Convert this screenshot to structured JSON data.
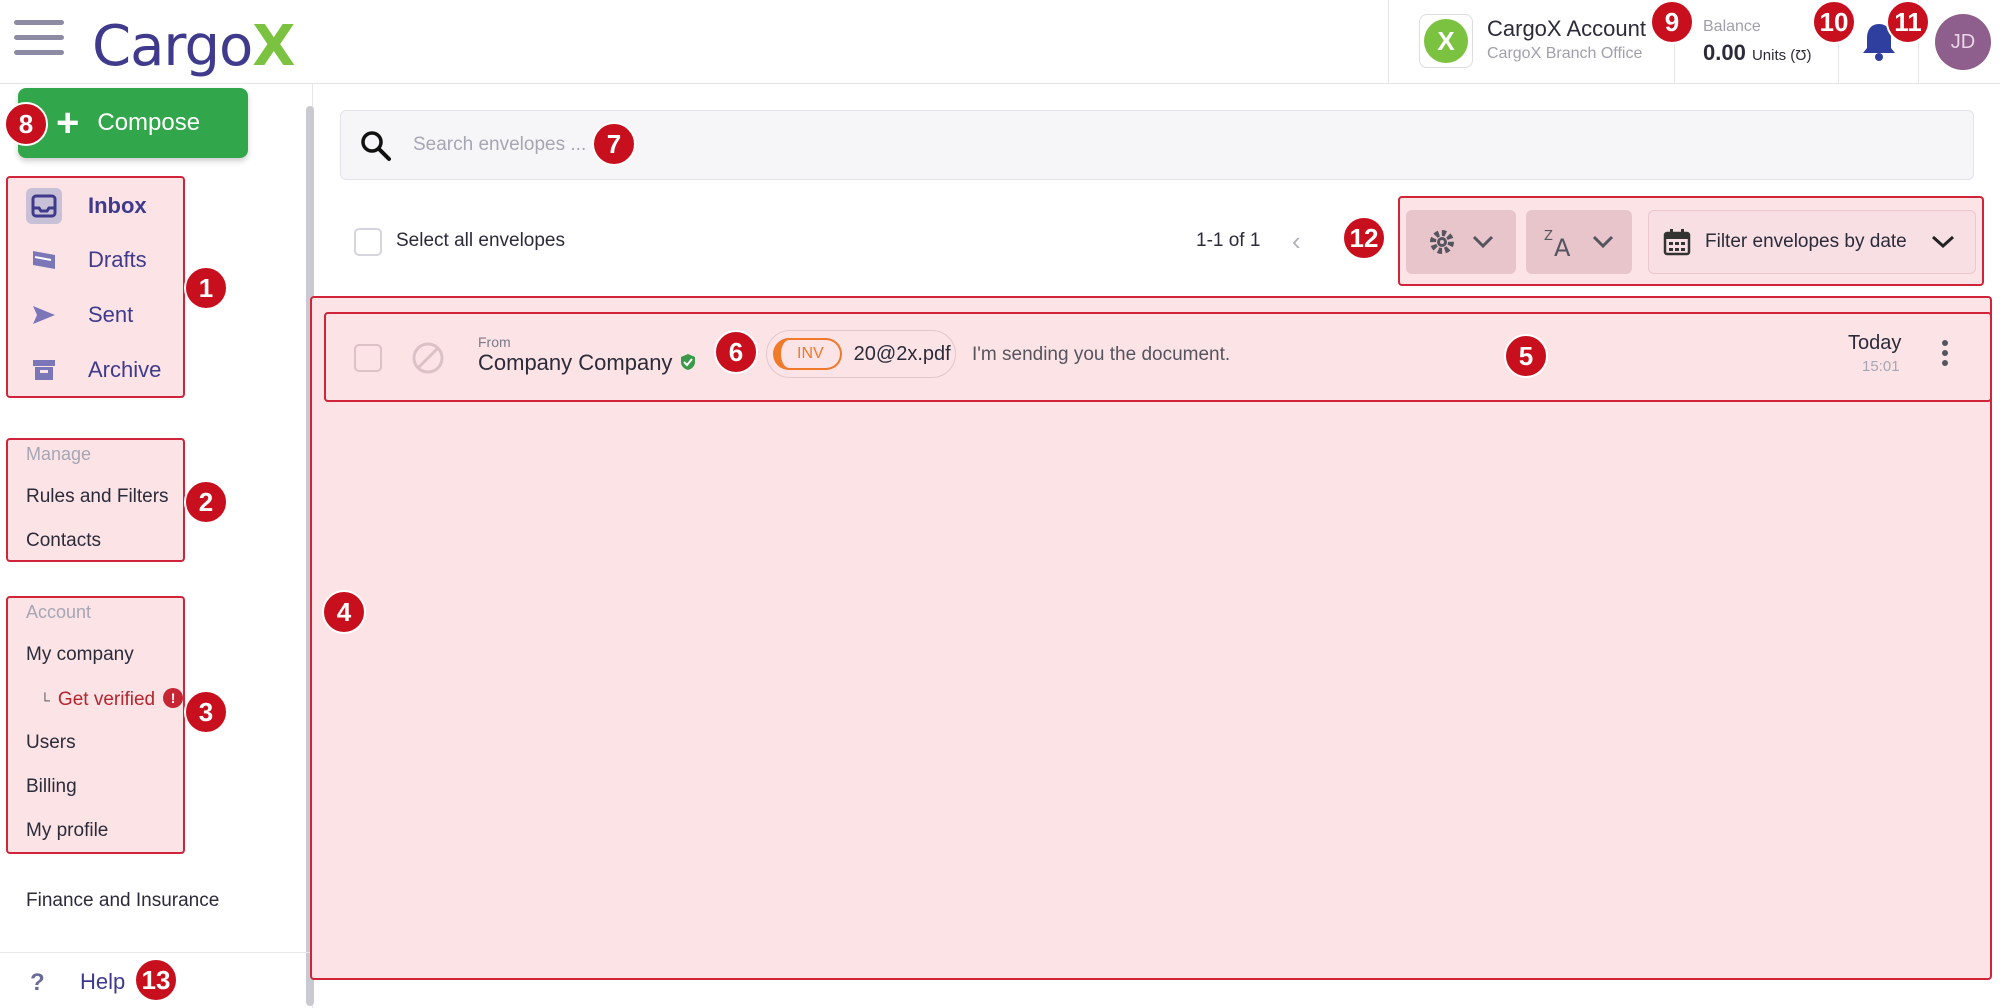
{
  "header": {
    "logo_text": "Cargo",
    "logo_x": "X",
    "account_name": "CargoX Account",
    "account_sub": "CargoX Branch Office",
    "balance_label": "Balance",
    "balance_value": "0.00",
    "balance_unit": "Units (Ʊ)",
    "avatar_initials": "JD"
  },
  "sidebar": {
    "compose_label": "Compose",
    "nav": [
      {
        "label": "Inbox",
        "active": true
      },
      {
        "label": "Drafts"
      },
      {
        "label": "Sent"
      },
      {
        "label": "Archive"
      }
    ],
    "manage_title": "Manage",
    "manage_items": [
      "Rules and Filters",
      "Contacts"
    ],
    "account_title": "Account",
    "account_items": [
      "My company",
      "Get verified",
      "Users",
      "Billing",
      "My profile"
    ],
    "verified_prefix": "└",
    "verified_alert": "!",
    "finance": "Finance and Insurance",
    "help": "Help",
    "help_icon": "?"
  },
  "main": {
    "search_placeholder": "Search envelopes ...",
    "select_all": "Select all envelopes",
    "pager": "1-1 of 1",
    "date_filter": "Filter envelopes by date",
    "envelopes": [
      {
        "from_label": "From",
        "from": "Company Company",
        "tag": "INV",
        "file": "20@2x.pdf",
        "subject": "I'm sending you the document.",
        "date": "Today",
        "time": "15:01"
      }
    ]
  },
  "badges": [
    "1",
    "2",
    "3",
    "4",
    "5",
    "6",
    "7",
    "8",
    "9",
    "10",
    "11",
    "12",
    "13"
  ],
  "colors": {
    "brand": "#3f3a8c",
    "accent_green": "#32a64a",
    "highlight": "#d0243a",
    "badge": "#c80f1e"
  }
}
